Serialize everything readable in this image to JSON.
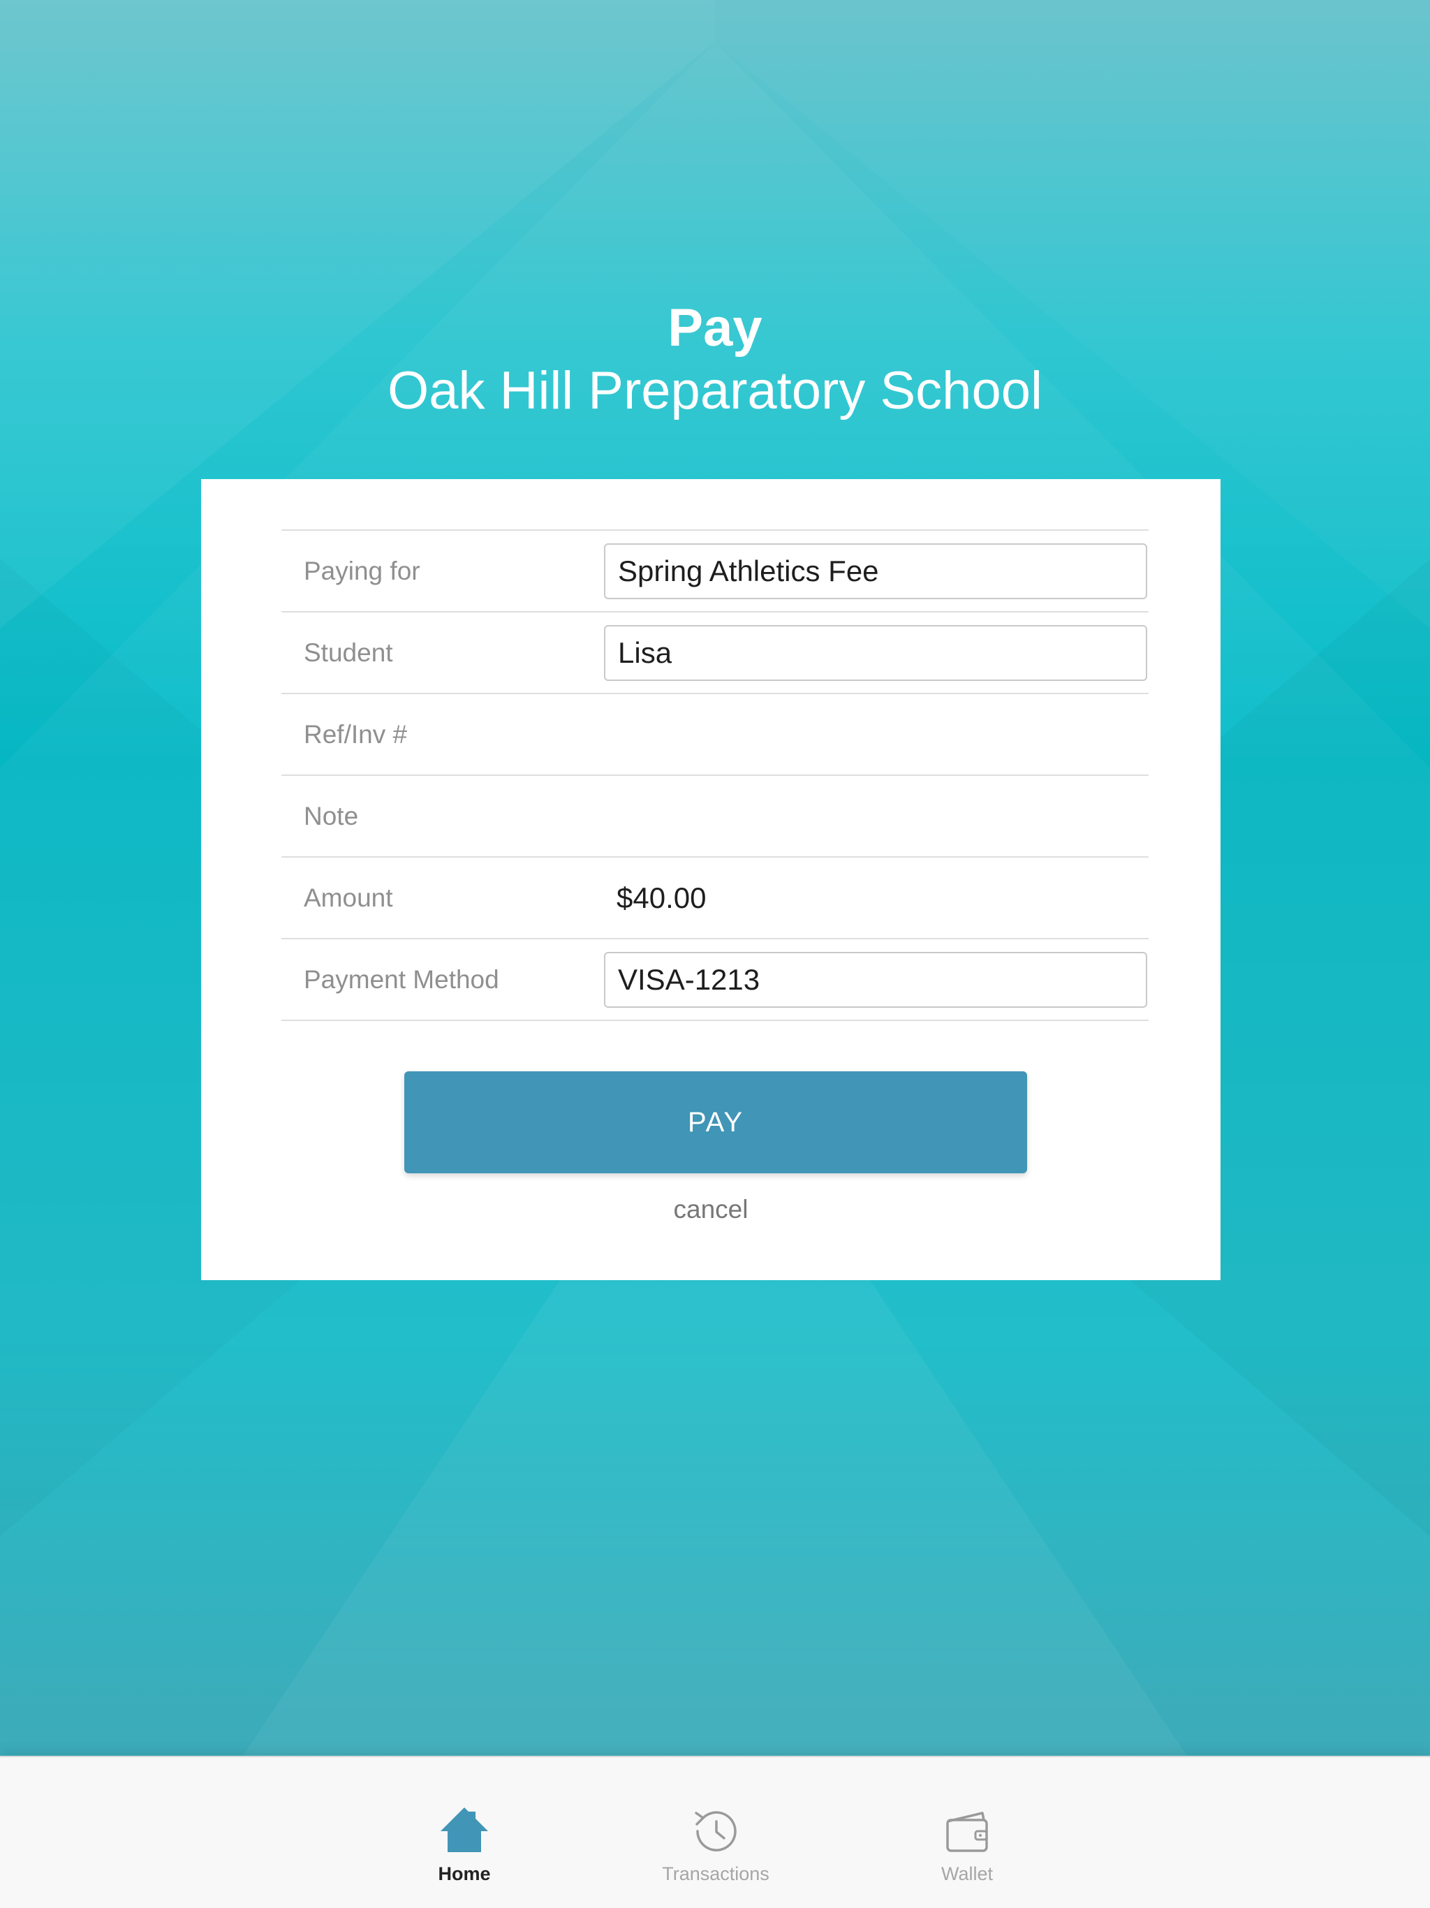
{
  "header": {
    "title": "Pay",
    "subtitle": "Oak Hill Preparatory School"
  },
  "form": {
    "rows": [
      {
        "label": "Paying for",
        "value": "Spring Athletics Fee",
        "kind": "field"
      },
      {
        "label": "Student",
        "value": "Lisa",
        "kind": "field"
      },
      {
        "label": "Ref/Inv #",
        "value": "",
        "kind": "empty"
      },
      {
        "label": "Note",
        "value": "",
        "kind": "empty"
      },
      {
        "label": "Amount",
        "value": "$40.00",
        "kind": "text"
      },
      {
        "label": "Payment Method",
        "value": "VISA-1213",
        "kind": "field"
      }
    ]
  },
  "actions": {
    "pay_label": "PAY",
    "cancel_label": "cancel"
  },
  "tabbar": {
    "tabs": [
      {
        "label": "Home",
        "icon": "home-icon",
        "active": true
      },
      {
        "label": "Transactions",
        "icon": "history-icon",
        "active": false
      },
      {
        "label": "Wallet",
        "icon": "wallet-icon",
        "active": false
      }
    ]
  },
  "colors": {
    "accent": "#4195b6",
    "background_teal": "#06bcc8",
    "inactive_icon": "#9a9a9a"
  }
}
